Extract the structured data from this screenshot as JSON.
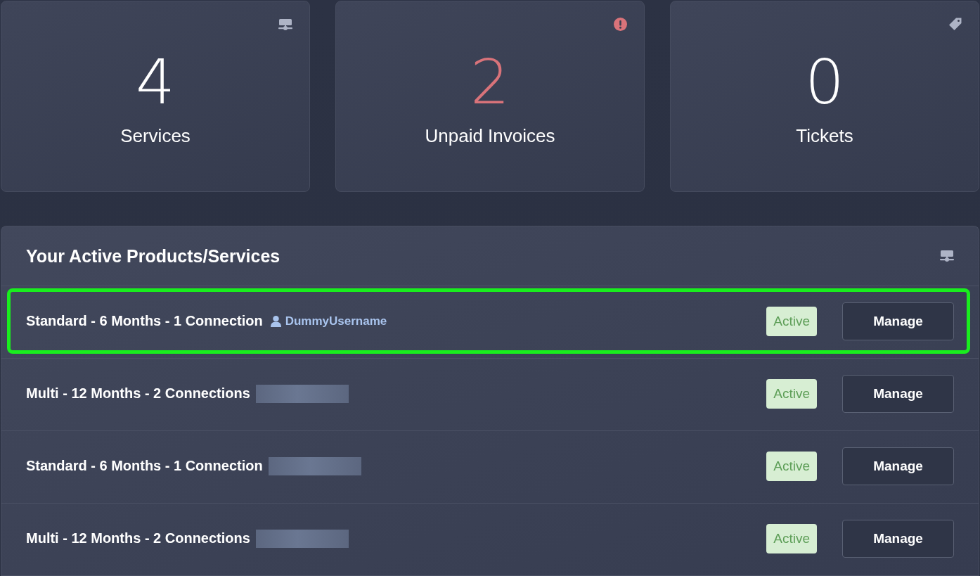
{
  "stats": [
    {
      "value": "4",
      "label": "Services",
      "color": "#ffffff"
    },
    {
      "value": "2",
      "label": "Unpaid Invoices",
      "color": "#d9737a"
    },
    {
      "value": "0",
      "label": "Tickets",
      "color": "#ffffff"
    }
  ],
  "products_panel": {
    "title": "Your Active Products/Services",
    "rows": [
      {
        "title": "Standard - 6 Months - 1 Connection",
        "username": "DummyUsername",
        "redacted": false,
        "highlighted": true,
        "status": "Active",
        "button": "Manage"
      },
      {
        "title": "Multi - 12 Months - 2 Connections",
        "redacted": true,
        "highlighted": false,
        "status": "Active",
        "button": "Manage"
      },
      {
        "title": "Standard - 6 Months - 1 Connection",
        "redacted": true,
        "highlighted": false,
        "status": "Active",
        "button": "Manage"
      },
      {
        "title": "Multi - 12 Months - 2 Connections",
        "redacted": true,
        "highlighted": false,
        "status": "Active",
        "button": "Manage"
      }
    ]
  }
}
